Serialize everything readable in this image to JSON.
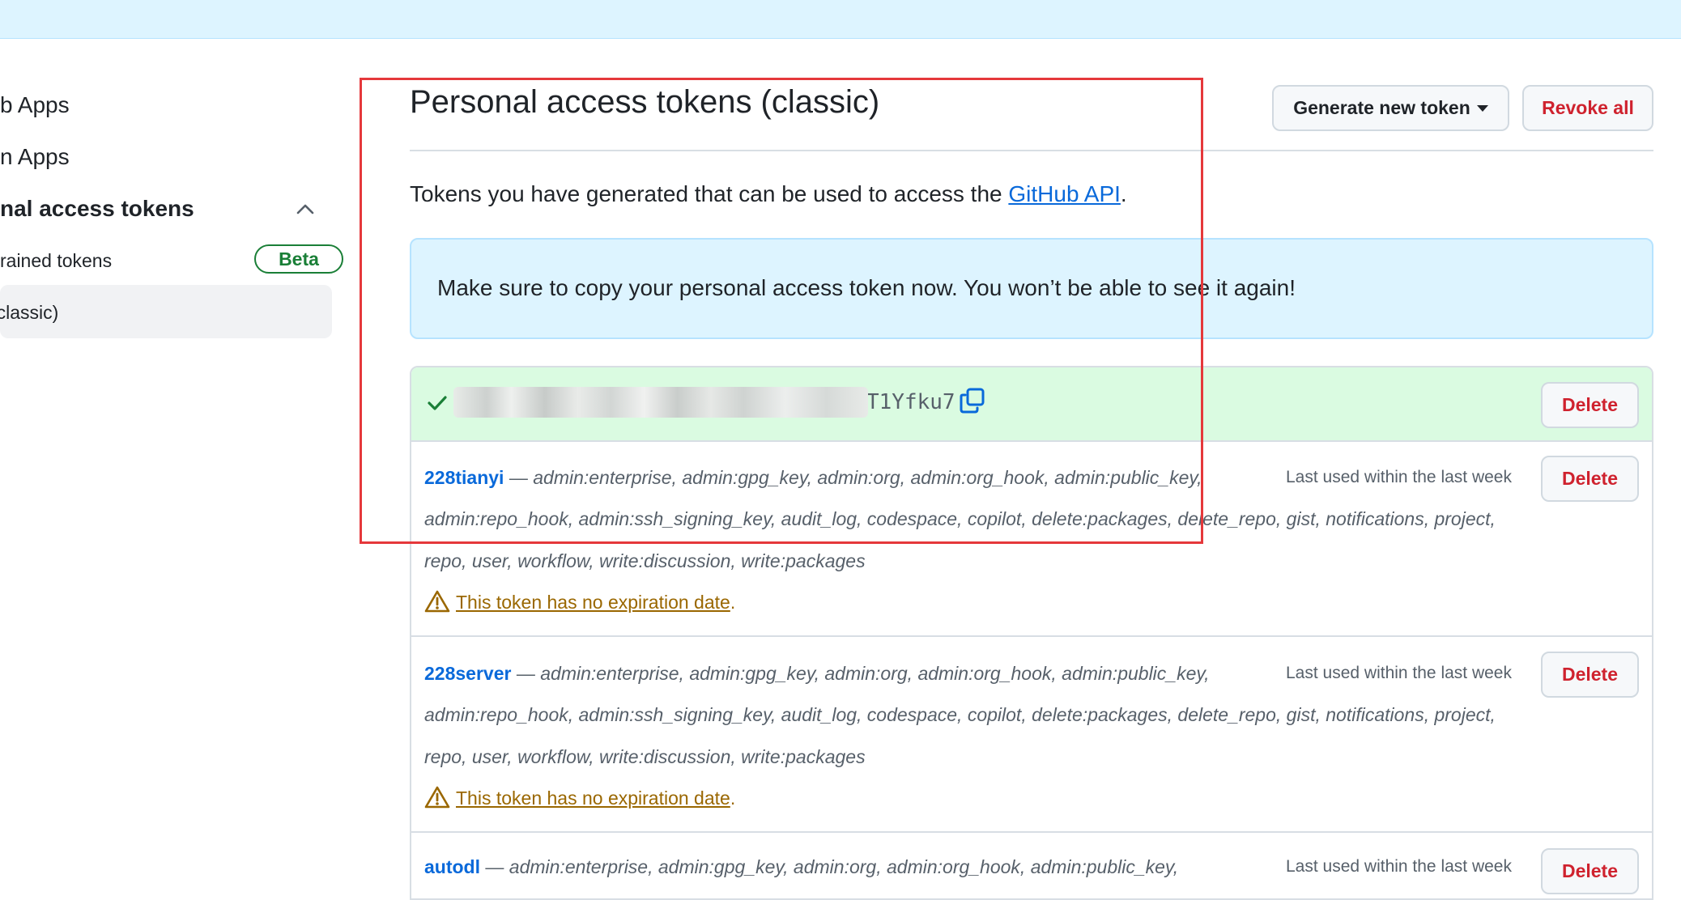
{
  "sidebar": {
    "item1": "b Apps",
    "item2": "n Apps",
    "section": "nal access tokens",
    "sub1": "rained tokens",
    "sub1_badge": "Beta",
    "sub2": "(classic)"
  },
  "header": {
    "title": "Personal access tokens (classic)",
    "generate_label": "Generate new token",
    "revoke_label": "Revoke all"
  },
  "description": {
    "prefix": "Tokens you have generated that can be used to access the ",
    "link": "GitHub API",
    "suffix": "."
  },
  "flash": "Make sure to copy your personal access token now. You won’t be able to see it again!",
  "new_token": {
    "value_visible": "T1Yfku7",
    "delete_label": "Delete"
  },
  "tokens": [
    {
      "name": "228tianyi",
      "dash": " — ",
      "scopes_line1": "admin:enterprise, admin:gpg_key, admin:org, admin:org_hook, admin:public_key,",
      "scopes_line2": "admin:repo_hook, admin:ssh_signing_key, audit_log, codespace, copilot, delete:packages, delete_repo, gist, notifications, project,",
      "scopes_line3": "repo, user, workflow, write:discussion, write:packages",
      "last_used": "Last used within the last week",
      "warning": "This token has no expiration date",
      "warning_suffix": ".",
      "delete_label": "Delete"
    },
    {
      "name": "228server",
      "dash": " — ",
      "scopes_line1": "admin:enterprise, admin:gpg_key, admin:org, admin:org_hook, admin:public_key,",
      "scopes_line2": "admin:repo_hook, admin:ssh_signing_key, audit_log, codespace, copilot, delete:packages, delete_repo, gist, notifications, project,",
      "scopes_line3": "repo, user, workflow, write:discussion, write:packages",
      "last_used": "Last used within the last week",
      "warning": "This token has no expiration date",
      "warning_suffix": ".",
      "delete_label": "Delete"
    },
    {
      "name": "autodl",
      "dash": " — ",
      "scopes_line1": "admin:enterprise, admin:gpg_key, admin:org, admin:org_hook, admin:public_key,",
      "last_used": "Last used within the last week",
      "delete_label": "Delete"
    }
  ],
  "colors": {
    "accent": "#0969da",
    "danger": "#cf222e",
    "success": "#1a7f37",
    "warning": "#9a6700",
    "annotation": "#e5383b"
  }
}
